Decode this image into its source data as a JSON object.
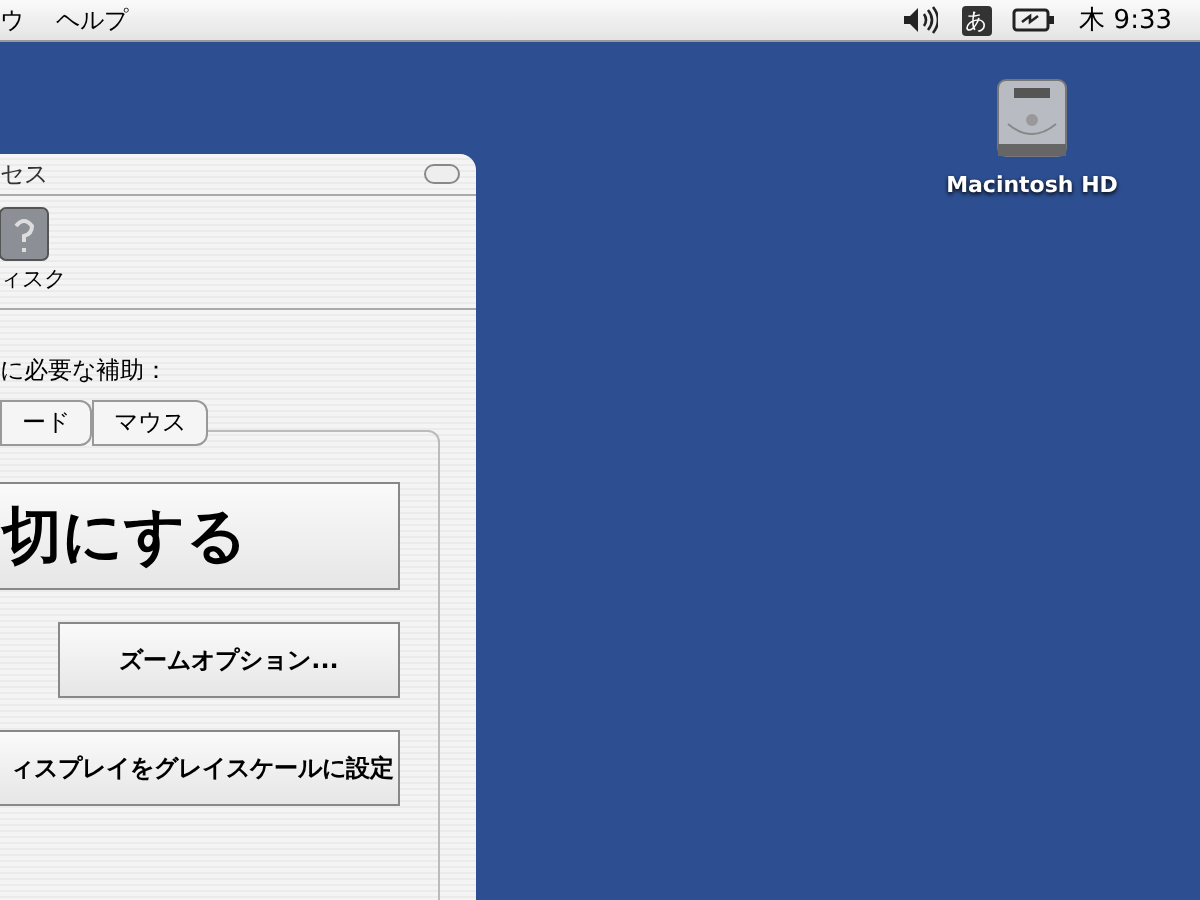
{
  "menu_bar": {
    "items": [
      "ウ",
      "ヘルプ"
    ],
    "input_method": "あ",
    "clock": "木 9:33"
  },
  "desktop": {
    "icons": [
      {
        "label": "Macintosh HD"
      }
    ]
  },
  "window": {
    "title": "セス",
    "toolbar": [
      {
        "label": "ィスク"
      }
    ],
    "prompt": "に必要な補助：",
    "tabs": [
      {
        "label": "ード",
        "selected": false
      },
      {
        "label": "マウス",
        "selected": false
      }
    ],
    "buttons": [
      {
        "label": "切にする",
        "kind": "large"
      },
      {
        "label": "ズームオプション...",
        "kind": "indented"
      },
      {
        "label": "ィスプレイをグレイスケールに設定",
        "kind": "normal"
      }
    ]
  }
}
